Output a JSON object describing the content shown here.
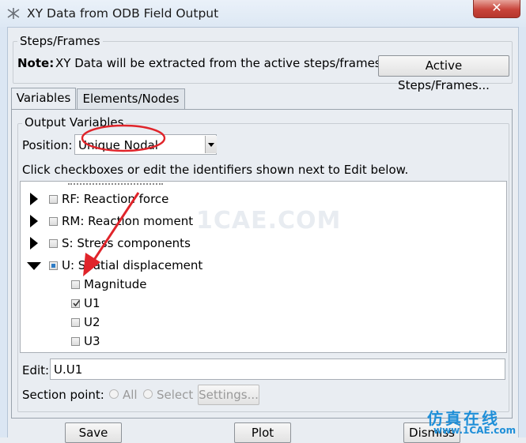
{
  "window": {
    "title": "XY Data from ODB Field Output",
    "close_label": "✕"
  },
  "steps_frames": {
    "legend": "Steps/Frames",
    "note_label": "Note:",
    "note_text": "XY Data will be extracted from the active steps/frames",
    "active_button": "Active Steps/Frames..."
  },
  "tabs": [
    {
      "label": "Variables",
      "active": true
    },
    {
      "label": "Elements/Nodes",
      "active": false
    }
  ],
  "output_variables": {
    "legend": "Output Variables",
    "position_label": "Position:",
    "position_value": "Unique Nodal",
    "instruction": "Click checkboxes or edit the identifiers shown next to Edit below."
  },
  "variables_list": [
    {
      "label": "RF: Reaction force",
      "expanded": false,
      "checked": false
    },
    {
      "label": "RM: Reaction moment",
      "expanded": false,
      "checked": false
    },
    {
      "label": "S: Stress components",
      "expanded": false,
      "checked": false
    },
    {
      "label": "U: Spatial displacement",
      "expanded": true,
      "checked": "partial",
      "children": [
        {
          "label": "Magnitude",
          "checked": false
        },
        {
          "label": "U1",
          "checked": true
        },
        {
          "label": "U2",
          "checked": false
        },
        {
          "label": "U3",
          "checked": false
        }
      ]
    }
  ],
  "edit": {
    "label": "Edit:",
    "value": "U.U1"
  },
  "section_point": {
    "label": "Section point:",
    "all_label": "All",
    "select_label": "Select",
    "settings_button": "Settings..."
  },
  "buttons": {
    "save": "Save",
    "plot": "Plot",
    "dismiss": "Dismiss"
  },
  "watermarks": [
    "1CAE.COM",
    "仿真在线",
    "www.1CAE.com"
  ],
  "colors": {
    "annotation_red": "#e0242a",
    "partial_check": "#2d7cc6"
  }
}
